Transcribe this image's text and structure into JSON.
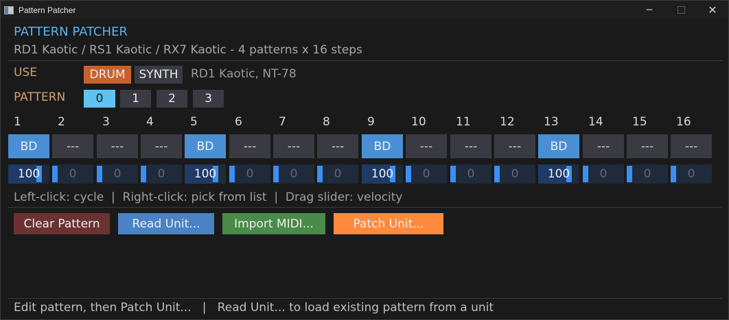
{
  "window": {
    "title": "Pattern Patcher"
  },
  "header": {
    "title": "PATTERN PATCHER",
    "subtitle": "RD1 Kaotic / RS1 Kaotic / RX7 Kaotic - 4 patterns x 16 steps"
  },
  "use": {
    "label": "USE",
    "options": [
      "DRUM",
      "SYNTH"
    ],
    "selected": "DRUM",
    "info": "RD1 Kaotic, NT-78"
  },
  "pattern": {
    "label": "PATTERN",
    "options": [
      "0",
      "1",
      "2",
      "3"
    ],
    "selected": "0"
  },
  "steps": {
    "numbers": [
      "1",
      "2",
      "3",
      "4",
      "5",
      "6",
      "7",
      "8",
      "9",
      "10",
      "11",
      "12",
      "13",
      "14",
      "15",
      "16"
    ],
    "labels": [
      "BD",
      "---",
      "---",
      "---",
      "BD",
      "---",
      "---",
      "---",
      "BD",
      "---",
      "---",
      "---",
      "BD",
      "---",
      "---",
      "---"
    ],
    "active": [
      true,
      false,
      false,
      false,
      true,
      false,
      false,
      false,
      true,
      false,
      false,
      false,
      true,
      false,
      false,
      false
    ],
    "velocities": [
      "100",
      "0",
      "0",
      "0",
      "100",
      "0",
      "0",
      "0",
      "100",
      "0",
      "0",
      "0",
      "100",
      "0",
      "0",
      "0"
    ],
    "velocity_max": 127
  },
  "hint": "Left-click: cycle  |  Right-click: pick from list  |  Drag slider: velocity",
  "buttons": {
    "clear": {
      "label": "Clear Pattern",
      "color": "#6a3232"
    },
    "read": {
      "label": "Read Unit...",
      "color": "#4a82c4"
    },
    "import": {
      "label": "Import MIDI...",
      "color": "#4a8a4a"
    },
    "patch": {
      "label": "Patch Unit...",
      "color": "#ff8a3d"
    }
  },
  "status": "Edit pattern, then Patch Unit...   |   Read Unit... to load existing pattern from a unit",
  "colors": {
    "accent": "#5ab4e8",
    "label": "#d4a070",
    "step_on": "#4a8fd4",
    "step_off": "#3a3a42"
  }
}
